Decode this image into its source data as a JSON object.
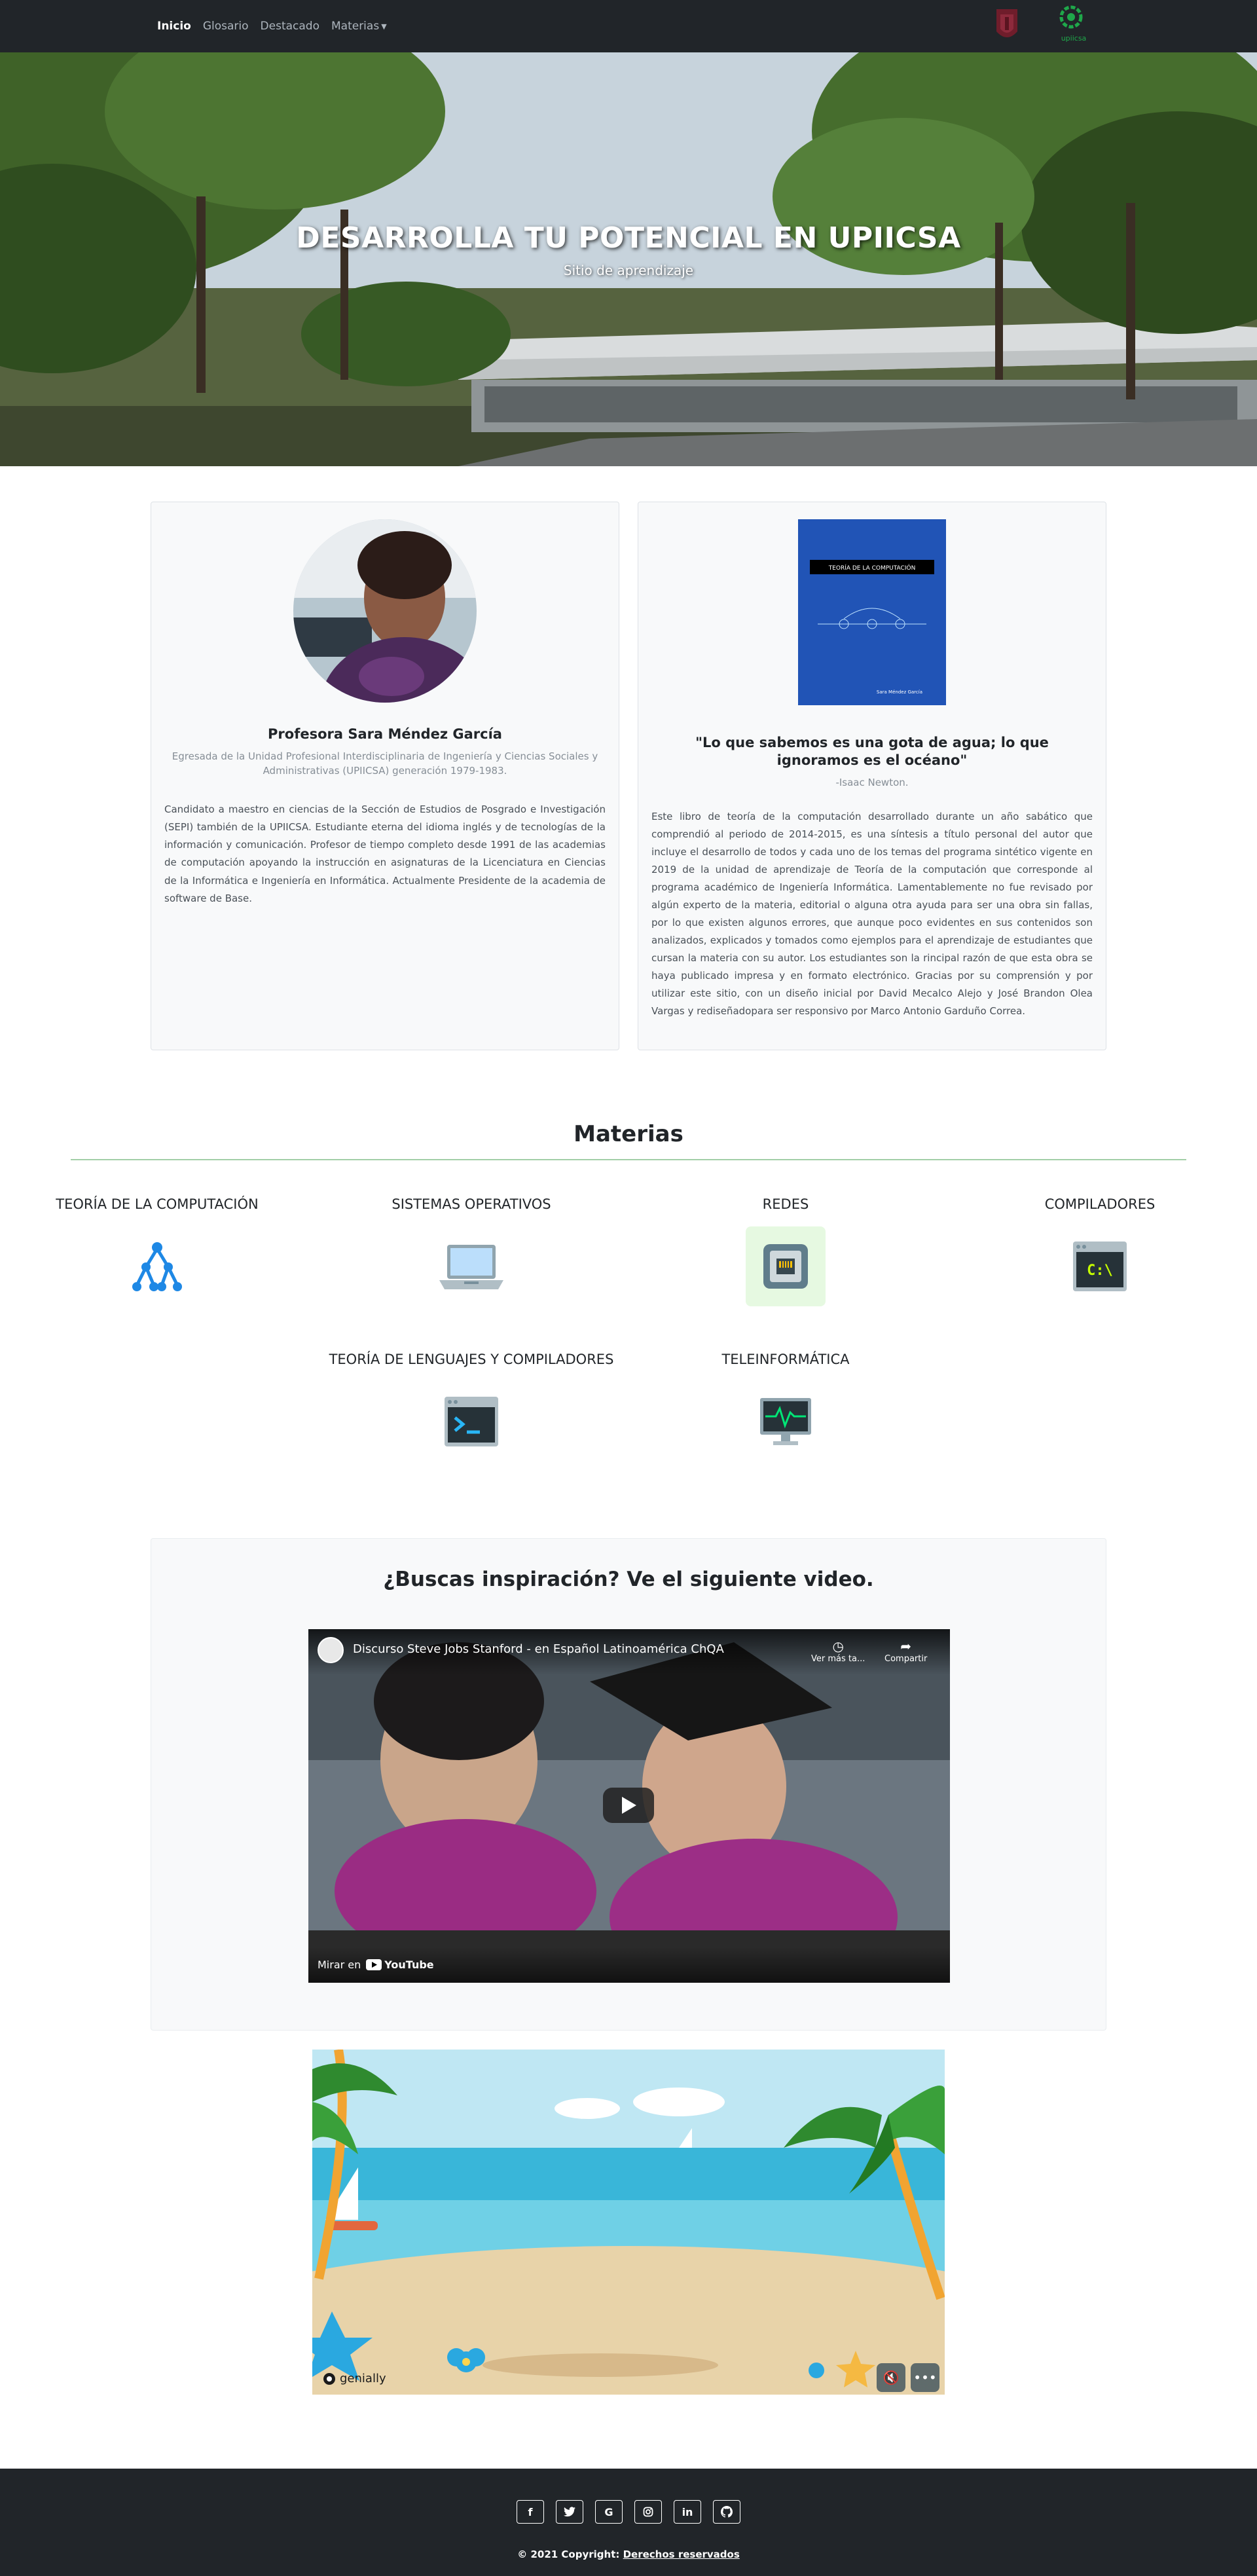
{
  "nav": {
    "items": [
      "Inicio",
      "Glosario",
      "Destacado",
      "Materias"
    ],
    "logo_upiicsa_text": "upiicsa"
  },
  "hero": {
    "title": "DESARROLLA TU POTENCIAL EN UPIICSA",
    "subtitle": "Sitio de aprendizaje"
  },
  "profile": {
    "name": "Profesora Sara Méndez García",
    "education": "Egresada de la Unidad Profesional Interdisciplinaria de Ingeniería y Ciencias Sociales y Administrativas (UPIICSA) generación 1979-1983.",
    "bio": "Candidato a maestro en ciencias de la Sección de Estudios de Posgrado e Investigación (SEPI) también de la UPIICSA. Estudiante eterna del idioma inglés y de tecnologías de la información y comunicación. Profesor de tiempo completo desde 1991 de las academias de computación apoyando la instrucción en asignaturas de la Licenciatura en Ciencias de la Informática e Ingeniería en Informática. Actualmente Presidente de la academia de software de Base."
  },
  "book": {
    "cover_title": "TEORÍA DE LA COMPUTACIÓN",
    "cover_author": "Sara Méndez García",
    "quote": "\"Lo que sabemos es una gota de agua; lo que ignoramos es el océano\"",
    "quote_author": "-Isaac Newton.",
    "description": "Este libro de teoría de la computación desarrollado durante un año sabático que comprendió al periodo de 2014-2015, es una síntesis a título personal del autor que incluye el desarrollo de todos y cada uno de los temas del programa sintético vigente en 2019 de la unidad de aprendizaje de Teoría de la computación que corresponde al programa académico de Ingeniería Informática. Lamentablemente no fue revisado por algún experto de la materia, editorial o alguna otra ayuda para ser una obra sin fallas, por lo que existen algunos errores, que aunque poco evidentes en sus contenidos son analizados, explicados y tomados como ejemplos para el aprendizaje de estudiantes que cursan la materia con su autor. Los estudiantes son la rincipal razón de que esta obra se haya publicado impresa y en formato electrónico. Gracias por su comprensión y por utilizar este sitio, con un diseño inicial por David Mecalco Alejo y José Brandon Olea Vargas y rediseñadopara ser responsivo por Marco Antonio Garduño Correa."
  },
  "materias": {
    "title": "Materias",
    "items": [
      {
        "name": "Teoría de la computación",
        "icon": "tree-structure-icon"
      },
      {
        "name": "Sistemas operativos",
        "icon": "laptop-icon"
      },
      {
        "name": "Redes",
        "icon": "ethernet-port-icon"
      },
      {
        "name": "Compiladores",
        "icon": "command-prompt-icon"
      },
      {
        "name": "Teoría de lenguajes y compiladores",
        "icon": "terminal-icon"
      },
      {
        "name": "Teleinformática",
        "icon": "monitor-pulse-icon"
      }
    ]
  },
  "video": {
    "heading": "¿Buscas inspiración? Ve el siguiente video.",
    "title": "Discurso Steve Jobs Stanford - en Español Latinoamérica ChQA",
    "watch_later": "Ver más ta...",
    "share": "Compartir",
    "watch_on": "Mirar en",
    "youtube": "YouTube"
  },
  "genially": {
    "brand": "genially"
  },
  "footer": {
    "social": [
      "f",
      "t",
      "G",
      "ig",
      "in",
      "gh"
    ],
    "copyright_prefix": "© 2021 Copyright: ",
    "copyright_link": "Derechos reservados"
  },
  "colors": {
    "navbar": "#212529",
    "accent_green": "#a3cfa8",
    "card_bg": "#f8f9fa"
  }
}
